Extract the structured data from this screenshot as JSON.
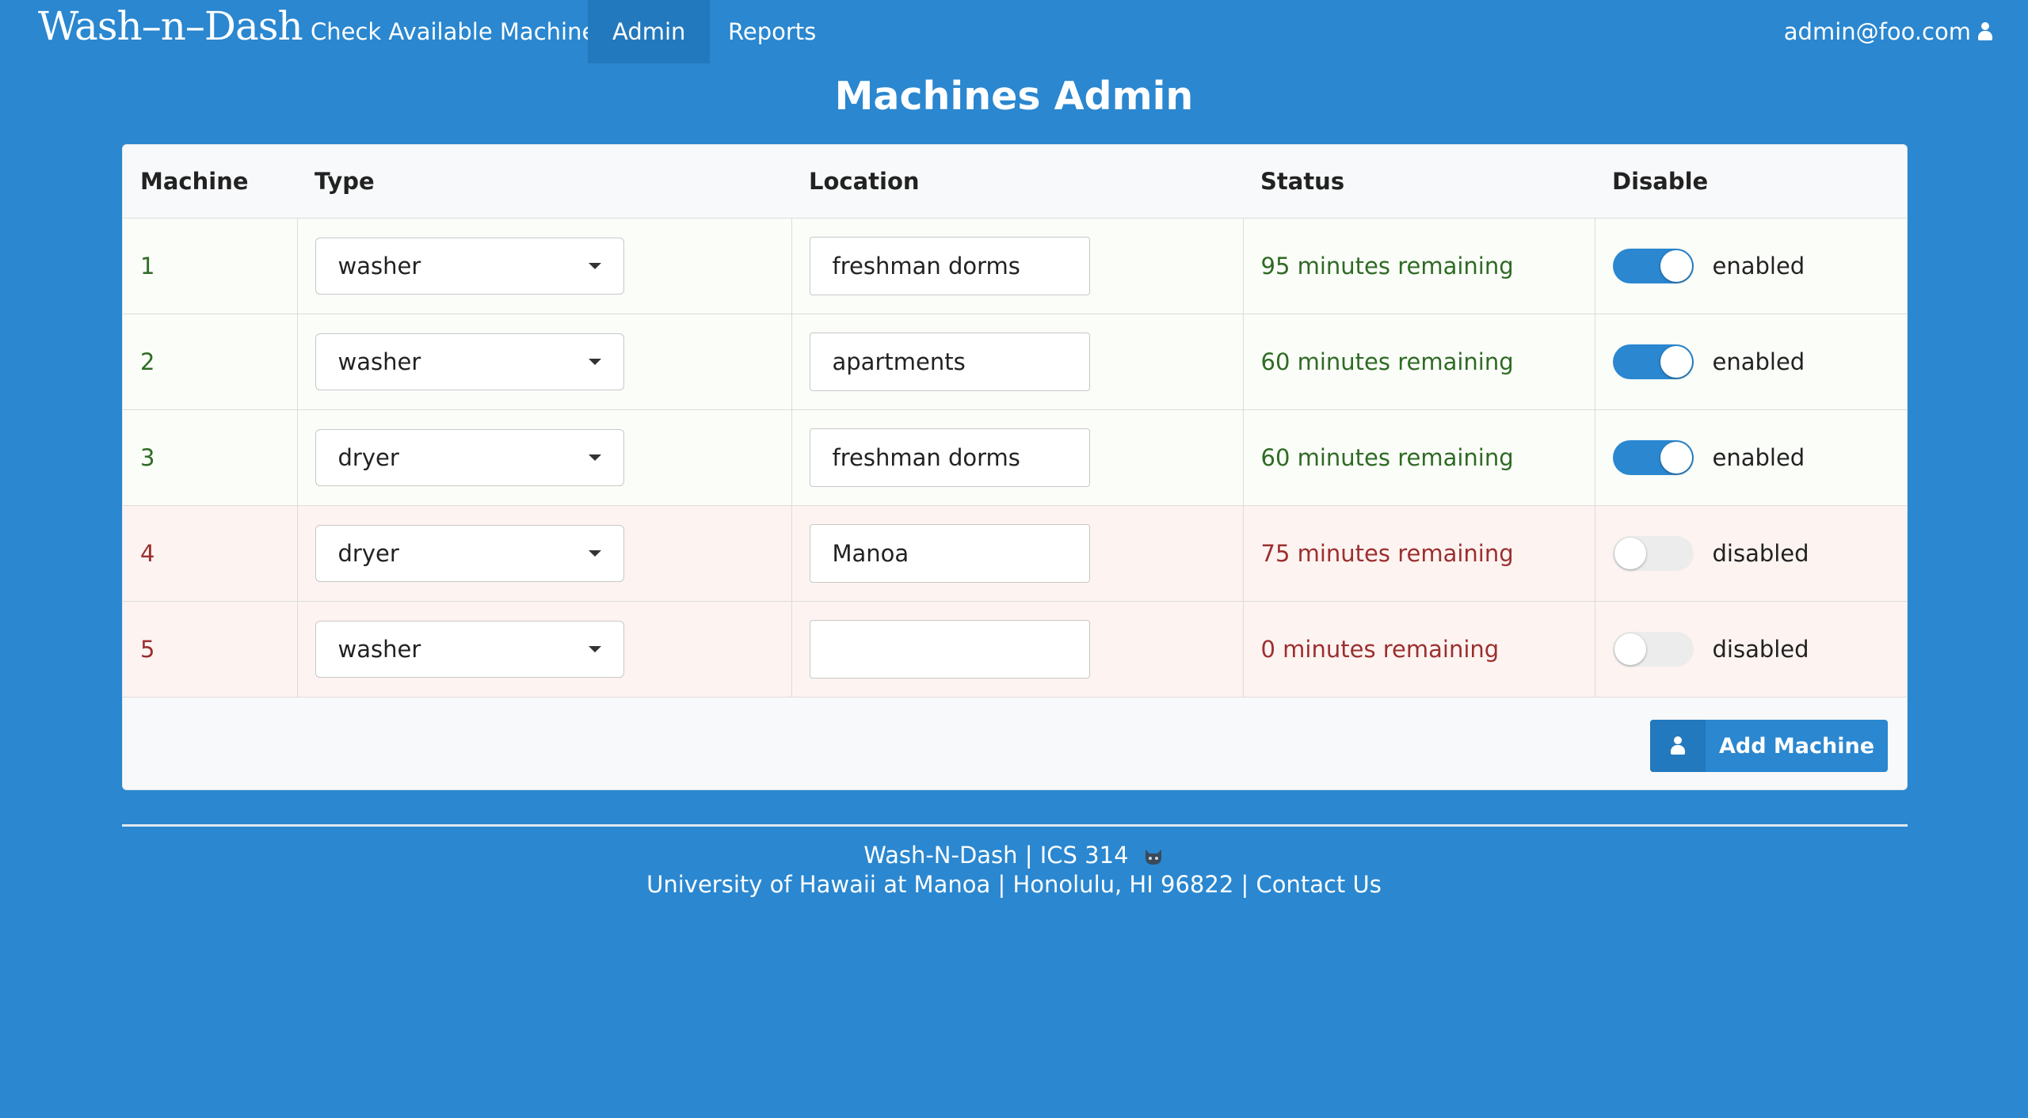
{
  "nav": {
    "logo": "Wash–n–Dash",
    "items": [
      {
        "label": "Check Available Machines"
      },
      {
        "label": "Admin"
      },
      {
        "label": "Reports"
      }
    ],
    "user": "admin@foo.com"
  },
  "page": {
    "title": "Machines Admin"
  },
  "table": {
    "headers": [
      "Machine",
      "Type",
      "Location",
      "Status",
      "Disable"
    ],
    "rows": [
      {
        "machine": "1",
        "type": "washer",
        "location": "freshman dorms",
        "status": "95 minutes remaining",
        "toggle": "enabled"
      },
      {
        "machine": "2",
        "type": "washer",
        "location": "apartments",
        "status": "60 minutes remaining",
        "toggle": "enabled"
      },
      {
        "machine": "3",
        "type": "dryer",
        "location": "freshman dorms",
        "status": "60 minutes remaining",
        "toggle": "enabled"
      },
      {
        "machine": "4",
        "type": "dryer",
        "location": "Manoa",
        "status": "75 minutes remaining",
        "toggle": "disabled"
      },
      {
        "machine": "5",
        "type": "washer",
        "location": "",
        "status": "0 minutes remaining",
        "toggle": "disabled"
      }
    ]
  },
  "actions": {
    "add_machine": "Add Machine"
  },
  "footer": {
    "line1": "Wash-N-Dash | ICS 314",
    "line2": "University of Hawaii at Manoa | Honolulu, HI 96822 | Contact Us"
  },
  "colors": {
    "background": "#2a87d0",
    "enabled_text": "#2e6b24",
    "disabled_text": "#9b2f2f",
    "toggle_on": "#2a87d0"
  }
}
